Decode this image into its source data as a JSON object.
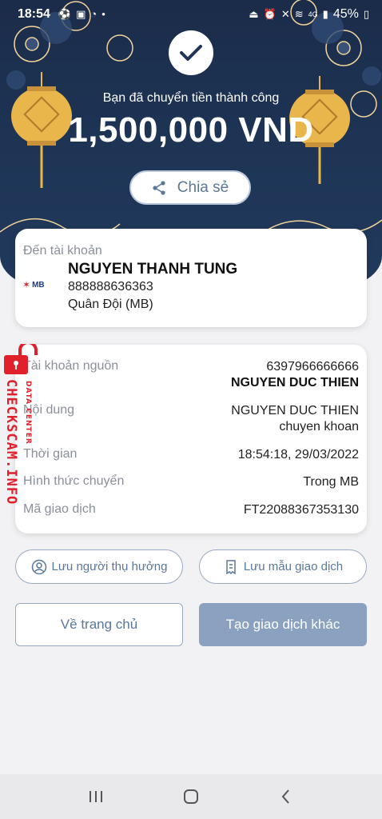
{
  "status_bar": {
    "time": "18:54",
    "left_icons": [
      "soccer-icon",
      "s-app-icon",
      "circle-app-icon",
      "dot-icon"
    ],
    "right_icons": [
      "alarm-lock-icon",
      "alarm-icon",
      "mute-icon",
      "wifi-icon",
      "signal-icon"
    ],
    "network_label": "4G",
    "battery": "45%"
  },
  "header": {
    "success_message": "Bạn đã chuyển tiền thành công",
    "amount": "1,500,000 VND",
    "share_label": "Chia sẻ",
    "colors": {
      "background": "#1e3556",
      "lantern": "#e8b64a"
    }
  },
  "recipient": {
    "label": "Đến tài khoản",
    "bank_logo_text": "MB",
    "name": "NGUYEN THANH TUNG",
    "account_number": "888888636363",
    "bank_name": "Quân Đội (MB)"
  },
  "details": {
    "source_account": {
      "label": "Tài khoản nguồn",
      "number": "6397966666666",
      "name": "NGUYEN DUC THIEN"
    },
    "content": {
      "label": "Nội dung",
      "line1": "NGUYEN DUC THIEN",
      "line2": "chuyen khoan"
    },
    "time": {
      "label": "Thời gian",
      "value": "18:54:18, 29/03/2022"
    },
    "method": {
      "label": "Hình thức chuyển",
      "value": "Trong MB"
    },
    "transaction_id": {
      "label": "Mã giao dịch",
      "value": "FT22088367353130"
    }
  },
  "actions": {
    "save_recipient": "Lưu người thụ hưởng",
    "save_template": "Lưu mẫu giao dịch",
    "home": "Về trang chủ",
    "new_transaction": "Tạo giao dịch khác",
    "accent_color": "#5b7799",
    "primary_button_color": "#8aa2bf"
  },
  "watermark": {
    "main": "CHECKSCAM.INFO",
    "sub": "DATA CENTER",
    "color": "#e0202a"
  },
  "nav_bar": {
    "buttons": [
      "recent-apps-icon",
      "home-icon",
      "back-icon"
    ]
  }
}
